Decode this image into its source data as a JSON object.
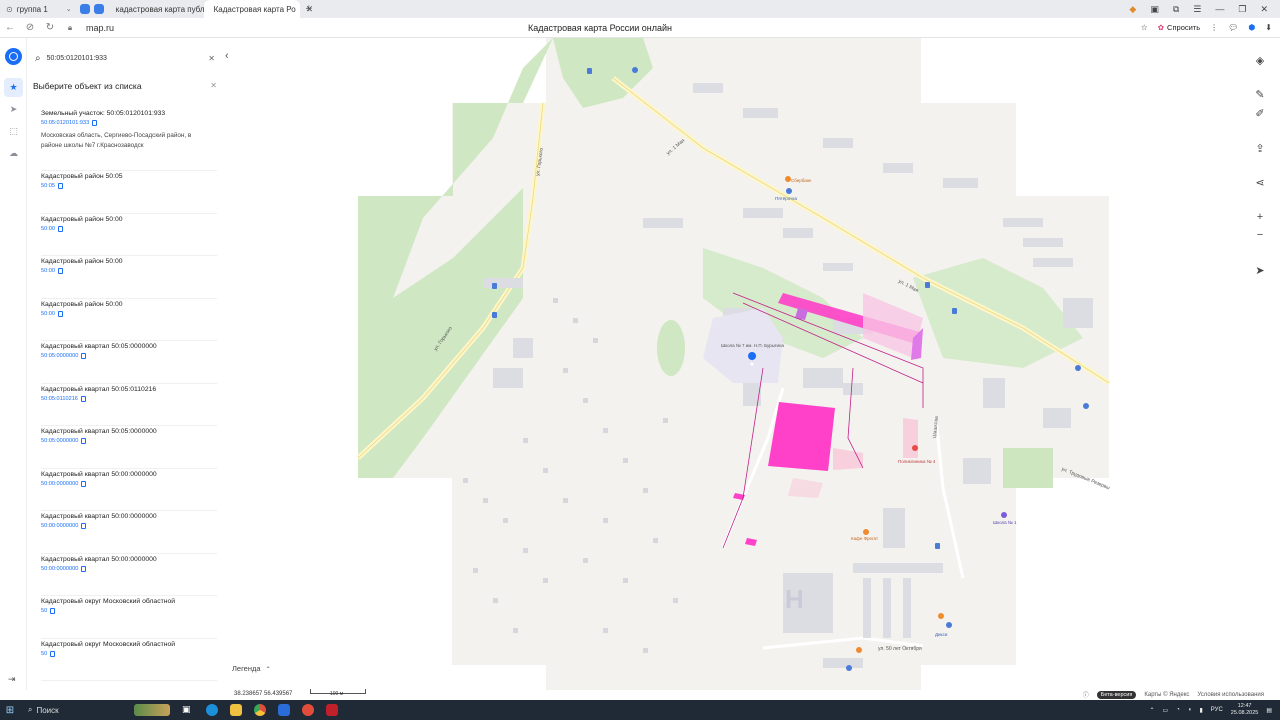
{
  "browser": {
    "tabs": [
      {
        "label": "группа 1",
        "active": false
      },
      {
        "label": "кадастровая карта публ",
        "active": false
      },
      {
        "label": "Кадастровая карта Ро",
        "active": true
      }
    ],
    "url": "map.ru",
    "page_title": "Кадастровая карта России онлайн",
    "ask_label": "Спросить"
  },
  "search": {
    "value": "50:05:0120101:933"
  },
  "list": {
    "header": "Выберите объект из списка",
    "items": [
      {
        "title": "Земельный участок: 50:05:0120101:933",
        "number": "50:05:0120101:933",
        "address": "Московская область, Сергиево-Посадский район, в районе школы №7 г.Краснозаводск"
      },
      {
        "title": "Кадастровый район 50:05",
        "number": "50:05"
      },
      {
        "title": "Кадастровый район 50:00",
        "number": "50:00"
      },
      {
        "title": "Кадастровый район 50:00",
        "number": "50:00"
      },
      {
        "title": "Кадастровый район 50:00",
        "number": "50:00"
      },
      {
        "title": "Кадастровый квартал 50:05:0000000",
        "number": "50:05:0000000"
      },
      {
        "title": "Кадастровый квартал 50:05:0110216",
        "number": "50:05:0110216"
      },
      {
        "title": "Кадастровый квартал 50:05:0000000",
        "number": "50:05:0000000"
      },
      {
        "title": "Кадастровый квартал 50:00:0000000",
        "number": "50:00:0000000"
      },
      {
        "title": "Кадастровый квартал 50:00:0000000",
        "number": "50:00:0000000"
      },
      {
        "title": "Кадастровый квартал 50:00:0000000",
        "number": "50:00:0000000"
      },
      {
        "title": "Кадастровый округ Московский областной",
        "number": "50"
      },
      {
        "title": "Кадастровый округ Московский областной",
        "number": "50"
      }
    ]
  },
  "map": {
    "street_labels": [
      "ул. 1 Мая",
      "ул. 1 Мая",
      "ул. Горького",
      "ул. Горького",
      "ул. 50 лет Октября",
      "ул. Трудовые Резервы",
      "Шашкова"
    ],
    "poi_labels": [
      "Школа № 7 им. Н.П. Бурыгина",
      "Сбербанк",
      "Пятёрочка",
      "Кафе Фрегат",
      "Поликлиника № 4",
      "Школа № 1",
      "Дикси"
    ],
    "legend_label": "Легенда",
    "coords": "38.238657  56.439567",
    "scale_label": "100 м",
    "beta_label": "Бета-версия",
    "attribution": "Карты © Яндекс",
    "terms": "Условия использования"
  },
  "taskbar": {
    "search_label": "Поиск",
    "lang": "РУС",
    "time": "12:47",
    "date": "25.08.2025"
  },
  "colors": {
    "accent": "#1a6ef5",
    "parcel": "#ff40c8"
  }
}
